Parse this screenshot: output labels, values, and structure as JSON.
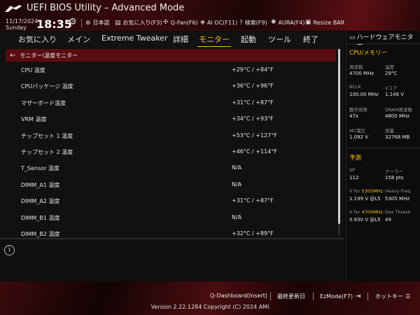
{
  "header": {
    "title": "UEFI BIOS Utility – Advanced Mode",
    "date": "11/17/2024",
    "day": "Sunday",
    "time": "18:35",
    "items": [
      {
        "icon": "globe-icon",
        "label": "日本語"
      },
      {
        "icon": "favorites-icon",
        "label": "お気に入り(F3)"
      },
      {
        "icon": "fan-icon",
        "label": "Q-Fan(F6)"
      },
      {
        "icon": "ai-oc-icon",
        "label": "AI OC(F11)"
      },
      {
        "icon": "help-search-icon",
        "label": "検索(F9)"
      },
      {
        "icon": "aura-icon",
        "label": "AURA(F4)"
      },
      {
        "icon": "resize-bar-icon",
        "label": "Resize BAR"
      }
    ]
  },
  "tabs": [
    {
      "label": "お気に入り",
      "active": false
    },
    {
      "label": "メイン",
      "active": false
    },
    {
      "label": "Extreme Tweaker",
      "active": false
    },
    {
      "label": "詳細",
      "active": false
    },
    {
      "label": "モニター",
      "active": true
    },
    {
      "label": "起動",
      "active": false
    },
    {
      "label": "ツール",
      "active": false
    },
    {
      "label": "終了",
      "active": false
    }
  ],
  "breadcrumb": "モニター\\温度モニター",
  "rows": [
    {
      "label": "CPU 温度",
      "value": "+29°C / +84°F"
    },
    {
      "label": "CPUパッケージ 温度",
      "value": "+36°C / +96°F"
    },
    {
      "label": "マザーボード温度",
      "value": "+31°C / +87°F"
    },
    {
      "label": "VRM 温度",
      "value": "+34°C / +93°F"
    },
    {
      "label": "チップセット 1 温度",
      "value": "+53°C / +127°F"
    },
    {
      "label": "チップセット 2 温度",
      "value": "+46°C / +114°F"
    },
    {
      "label": "T_Sensor 温度",
      "value": "N/A"
    },
    {
      "label": "DIMM_A1 温度",
      "value": "N/A"
    },
    {
      "label": "DIMM_A2 温度",
      "value": "+31°C / +87°F"
    },
    {
      "label": "DIMM_B1 温度",
      "value": "N/A"
    },
    {
      "label": "DIMM_B2 温度",
      "value": "+32°C / +89°F"
    }
  ],
  "panel": {
    "title": "ハードウェアモニター",
    "cpu_mem": {
      "heading": "CPU/メモリー",
      "cells": [
        {
          "label": "周波数",
          "value": "4700 MHz"
        },
        {
          "label": "温度",
          "value": "29°C"
        },
        {
          "label": "BCLK",
          "value": "100.00 MHz"
        },
        {
          "label": "Vコア",
          "value": "1.146 V"
        },
        {
          "label": "動作倍率",
          "value": "47x"
        },
        {
          "label": "DRAM周波数",
          "value": "4800 MHz"
        },
        {
          "label": "MC電圧",
          "value": "1.092 V"
        },
        {
          "label": "容量",
          "value": "32768 MB"
        }
      ]
    },
    "prediction": {
      "heading": "予測",
      "sp_label": "SP",
      "sp_value": "112",
      "cooler_label": "クーラー",
      "cooler_value": "158 pts",
      "v1_prefix": "V for ",
      "v1_freq": "5305MHz",
      "v1_value": "1.199 V @L5",
      "heavy_label": "Heavy Freq",
      "heavy_value": "5305 MHz",
      "v2_prefix": "V for ",
      "v2_freq": "4700MHz",
      "v2_value": "0.930 V @L5",
      "dos_label": "Dos Thresh",
      "dos_value": "49"
    }
  },
  "footer": {
    "qdashboard": "Q-Dashboard(Insert)",
    "last_modified": "最終更新日",
    "ezmode": "EzMode(F7)",
    "hotkeys": "ホットキー",
    "copyright": "Version 2.22.1284 Copyright (C) 2024 AMI"
  },
  "colors": {
    "accent": "#f4c20d",
    "header_red": "#5c0f14",
    "breadcrumb_bg": "#5a0c10"
  }
}
